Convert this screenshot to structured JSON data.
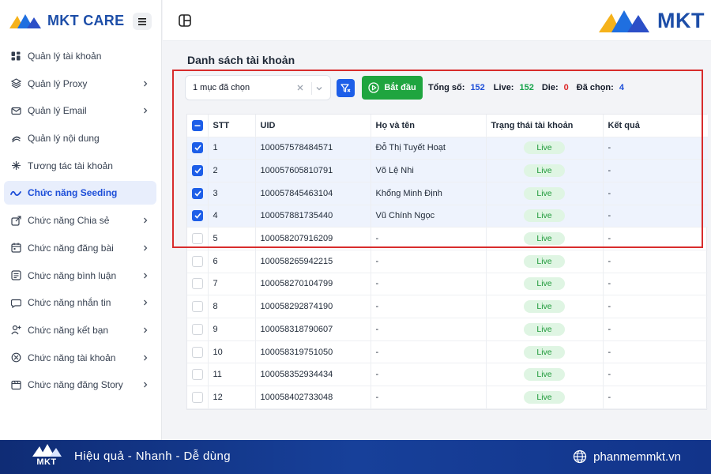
{
  "sidebar": {
    "brand": "MKT CARE",
    "items": [
      {
        "label": "Quản lý tài khoản",
        "icon": "dashboard-icon",
        "chevron": false,
        "active": false
      },
      {
        "label": "Quản lý Proxy",
        "icon": "layers-icon",
        "chevron": true,
        "active": false
      },
      {
        "label": "Quản lý Email",
        "icon": "mail-icon",
        "chevron": true,
        "active": false
      },
      {
        "label": "Quản lý nội dung",
        "icon": "link-icon",
        "chevron": false,
        "active": false
      },
      {
        "label": "Tương tác tài khoản",
        "icon": "sparkle-icon",
        "chevron": false,
        "active": false
      },
      {
        "label": "Chức năng Seeding",
        "icon": "wave-icon",
        "chevron": false,
        "active": true
      },
      {
        "label": "Chức năng Chia sẻ",
        "icon": "share-icon",
        "chevron": true,
        "active": false
      },
      {
        "label": "Chức năng đăng bài",
        "icon": "calendar-icon",
        "chevron": true,
        "active": false
      },
      {
        "label": "Chức năng bình luận",
        "icon": "comment-icon",
        "chevron": true,
        "active": false
      },
      {
        "label": "Chức năng nhắn tin",
        "icon": "chat-icon",
        "chevron": true,
        "active": false
      },
      {
        "label": "Chức năng kết bạn",
        "icon": "user-plus-icon",
        "chevron": true,
        "active": false
      },
      {
        "label": "Chức năng tài khoản",
        "icon": "block-icon",
        "chevron": true,
        "active": false
      },
      {
        "label": "Chức năng đăng Story",
        "icon": "film-icon",
        "chevron": true,
        "active": false
      }
    ]
  },
  "topbar": {
    "logo_text": "MKT"
  },
  "main": {
    "title": "Danh sách tài khoản",
    "select_value": "1 mục đã chọn",
    "start_label": "Bắt đầu",
    "stats": {
      "total_label": "Tổng số:",
      "total": "152",
      "live_label": "Live:",
      "live": "152",
      "die_label": "Die:",
      "die": "0",
      "selected_label": "Đã chọn:",
      "selected": "4"
    },
    "colors": {
      "total": "#1d4ed8",
      "live": "#16a34a",
      "die": "#dc2626",
      "selected": "#1d4ed8",
      "accent": "#1d5ee8",
      "highlight": "#d82c2c"
    },
    "table": {
      "headers": [
        "STT",
        "UID",
        "Họ và tên",
        "Trạng thái tài khoản",
        "Kết quả"
      ],
      "rows": [
        {
          "stt": "1",
          "uid": "100057578484571",
          "name": "Đỗ Thị Tuyết Hoạt",
          "status": "Live",
          "result": "-",
          "checked": true
        },
        {
          "stt": "2",
          "uid": "100057605810791",
          "name": "Võ Lệ Nhi",
          "status": "Live",
          "result": "-",
          "checked": true
        },
        {
          "stt": "3",
          "uid": "100057845463104",
          "name": "Khổng Minh Định",
          "status": "Live",
          "result": "-",
          "checked": true
        },
        {
          "stt": "4",
          "uid": "100057881735440",
          "name": "Vũ Chính Ngọc",
          "status": "Live",
          "result": "-",
          "checked": true
        },
        {
          "stt": "5",
          "uid": "100058207916209",
          "name": "-",
          "status": "Live",
          "result": "-",
          "checked": false
        },
        {
          "stt": "6",
          "uid": "100058265942215",
          "name": "-",
          "status": "Live",
          "result": "-",
          "checked": false
        },
        {
          "stt": "7",
          "uid": "100058270104799",
          "name": "-",
          "status": "Live",
          "result": "-",
          "checked": false
        },
        {
          "stt": "8",
          "uid": "100058292874190",
          "name": "-",
          "status": "Live",
          "result": "-",
          "checked": false
        },
        {
          "stt": "9",
          "uid": "100058318790607",
          "name": "-",
          "status": "Live",
          "result": "-",
          "checked": false
        },
        {
          "stt": "10",
          "uid": "100058319751050",
          "name": "-",
          "status": "Live",
          "result": "-",
          "checked": false
        },
        {
          "stt": "11",
          "uid": "100058352934434",
          "name": "-",
          "status": "Live",
          "result": "-",
          "checked": false
        },
        {
          "stt": "12",
          "uid": "100058402733048",
          "name": "-",
          "status": "Live",
          "result": "-",
          "checked": false
        }
      ]
    }
  },
  "footer": {
    "logo_text": "MKT",
    "tagline": "Hiệu quả - Nhanh - Dễ dùng",
    "website": "phanmemmkt.vn"
  }
}
